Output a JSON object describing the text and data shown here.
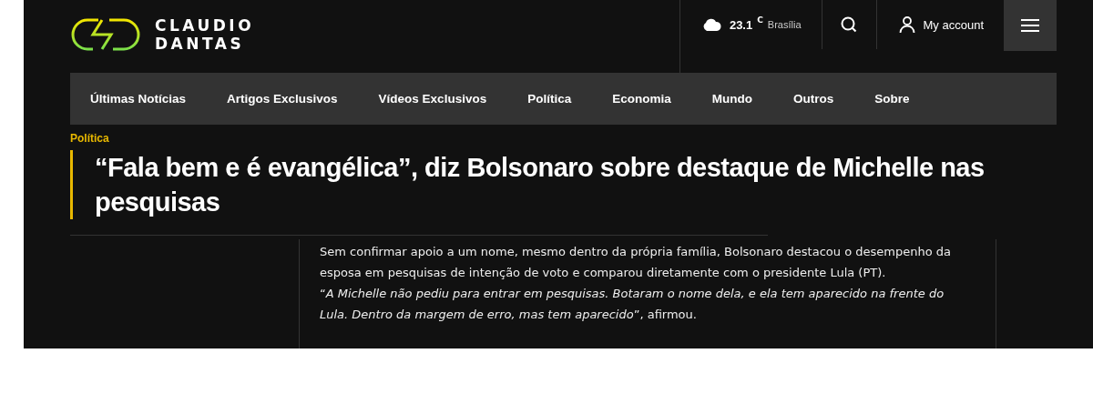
{
  "logo": {
    "line_1": "CLAUDIO",
    "line_2": "DANTAS"
  },
  "weather": {
    "temperature": "23.1",
    "unit": "C",
    "city": "Brasília"
  },
  "account": {
    "label": "My account"
  },
  "nav": [
    {
      "label": "Últimas Notícias"
    },
    {
      "label": "Artigos Exclusivos"
    },
    {
      "label": "Vídeos Exclusivos"
    },
    {
      "label": "Política"
    },
    {
      "label": "Economia"
    },
    {
      "label": "Mundo"
    },
    {
      "label": "Outros"
    },
    {
      "label": "Sobre"
    }
  ],
  "article": {
    "category": "Política",
    "headline": "“Fala bem e é evangélica”, diz Bolsonaro sobre destaque de Michelle nas pesquisas",
    "paragraphs": [
      "Sem confirmar apoio a um nome, mesmo dentro da própria família, Bolsonaro destacou o desempenho da esposa em pesquisas de intenção de voto e comparou diretamente com o presidente Lula (PT).",
      "“*A Michelle não pediu para entrar em pesquisas. Botaram o nome dela, e ela tem aparecido na frente do Lula. Dentro da margem de erro, mas tem aparecido*”, afirmou."
    ]
  }
}
